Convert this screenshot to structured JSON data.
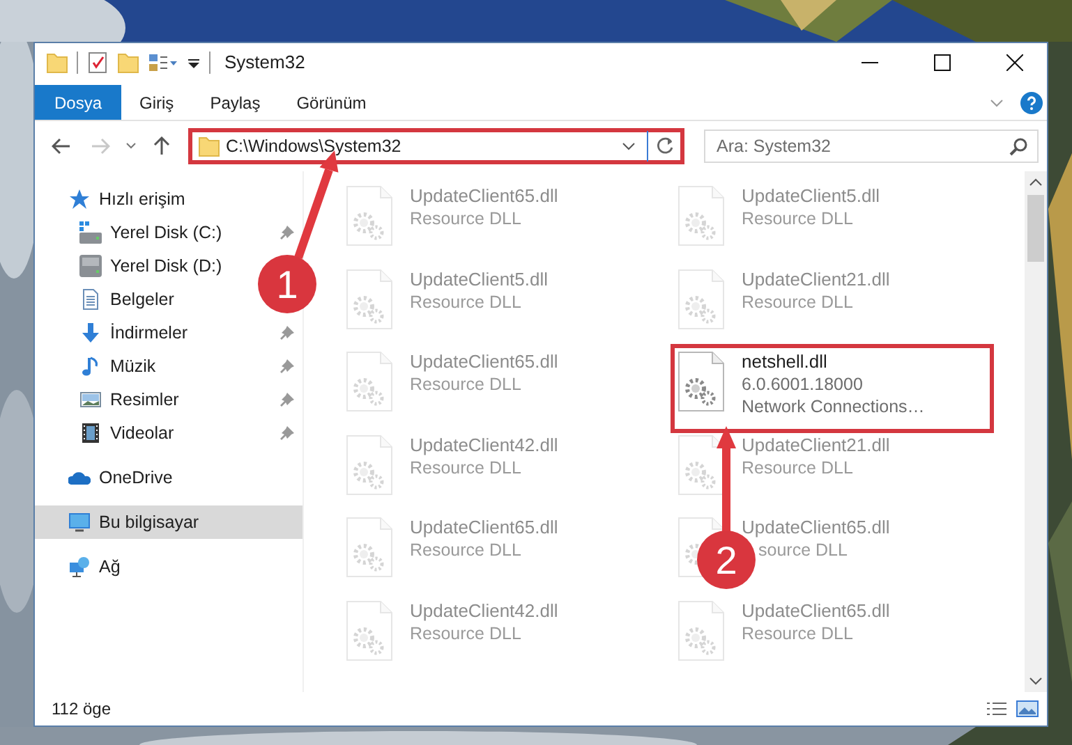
{
  "window": {
    "title": "System32"
  },
  "ribbon": {
    "tabs": [
      {
        "label": "Dosya",
        "selected": true
      },
      {
        "label": "Giriş",
        "selected": false
      },
      {
        "label": "Paylaş",
        "selected": false
      },
      {
        "label": "Görünüm",
        "selected": false
      }
    ]
  },
  "address_bar": {
    "path": "C:\\Windows\\System32",
    "highlighted": true
  },
  "search": {
    "placeholder": "Ara: System32"
  },
  "nav_pane": {
    "items": [
      {
        "label": "Hızlı erişim",
        "kind": "quick-access",
        "selected": false,
        "children": [
          {
            "label": "Yerel Disk (C:)",
            "kind": "system-drive",
            "pinned": true
          },
          {
            "label": "Yerel Disk (D:)",
            "kind": "drive",
            "pinned": false
          },
          {
            "label": "Belgeler",
            "kind": "documents",
            "pinned": false
          },
          {
            "label": "İndirmeler",
            "kind": "downloads",
            "pinned": true
          },
          {
            "label": "Müzik",
            "kind": "music",
            "pinned": true
          },
          {
            "label": "Resimler",
            "kind": "pictures",
            "pinned": true
          },
          {
            "label": "Videolar",
            "kind": "videos",
            "pinned": true
          }
        ]
      },
      {
        "label": "OneDrive",
        "kind": "cloud",
        "selected": false
      },
      {
        "label": "Bu bilgisayar",
        "kind": "computer",
        "selected": true
      },
      {
        "label": "Ağ",
        "kind": "network",
        "selected": false
      }
    ]
  },
  "files": [
    {
      "name": "UpdateClient65.dll",
      "type": "Resource DLL",
      "blurred": true,
      "highlighted": false
    },
    {
      "name": "UpdateClient5.dll",
      "type": "Resource DLL",
      "blurred": true,
      "highlighted": false
    },
    {
      "name": "UpdateClient5.dll",
      "type": "Resource DLL",
      "blurred": true,
      "highlighted": false
    },
    {
      "name": "UpdateClient21.dll",
      "type": "Resource DLL",
      "blurred": true,
      "highlighted": false
    },
    {
      "name": "UpdateClient65.dll",
      "type": "Resource DLL",
      "blurred": true,
      "highlighted": false
    },
    {
      "name": "netshell.dll",
      "version": "6.0.6001.18000",
      "description": "Network Connections…",
      "blurred": false,
      "highlighted": true
    },
    {
      "name": "UpdateClient42.dll",
      "type": "Resource DLL",
      "blurred": true,
      "highlighted": false
    },
    {
      "name": "UpdateClient21.dll",
      "type": "Resource DLL",
      "blurred": true,
      "highlighted": false
    },
    {
      "name": "UpdateClient65.dll",
      "type": "Resource DLL",
      "blurred": true,
      "highlighted": false
    },
    {
      "name": "UpdateClient65.dll",
      "type": "source DLL",
      "blurred": true,
      "highlighted": false,
      "partly_hidden": true
    },
    {
      "name": "UpdateClient42.dll",
      "type": "Resource DLL",
      "blurred": true,
      "highlighted": false
    },
    {
      "name": "UpdateClient65.dll",
      "type": "Resource DLL",
      "blurred": true,
      "highlighted": false
    }
  ],
  "status_bar": {
    "item_count": "112 öge"
  },
  "callouts": [
    {
      "number": "1"
    },
    {
      "number": "2"
    }
  ]
}
